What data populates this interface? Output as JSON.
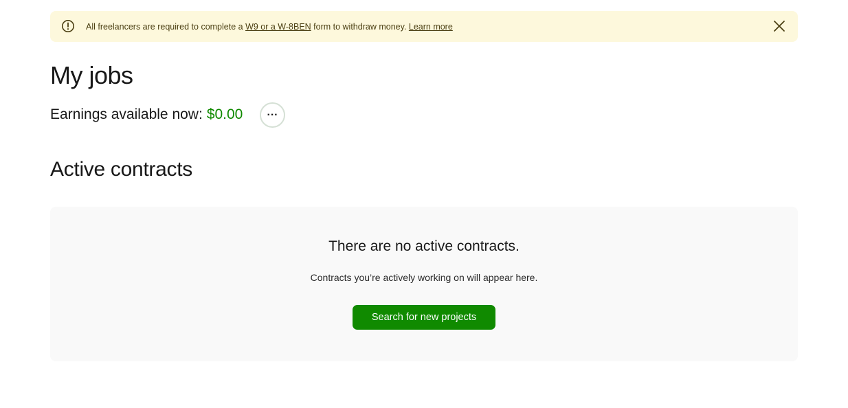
{
  "alert": {
    "icon": "info-circle-icon",
    "text_before": "All freelancers are required to complete a ",
    "form_link": "W9 or a W-8BEN",
    "text_after": " form to withdraw money. ",
    "learn_more": "Learn more",
    "close_icon": "close-icon",
    "background": "#fdf8dc"
  },
  "page": {
    "title": "My jobs"
  },
  "earnings": {
    "label": "Earnings available now:",
    "amount": "$0.00",
    "amount_color": "#108a00",
    "more_label": "···",
    "more_icon": "more-horizontal-icon"
  },
  "contracts": {
    "title": "Active contracts",
    "empty_title": "There are no active contracts.",
    "empty_sub": "Contracts you’re actively working on will appear here.",
    "search_button": "Search for new projects",
    "button_color": "#108a00"
  }
}
